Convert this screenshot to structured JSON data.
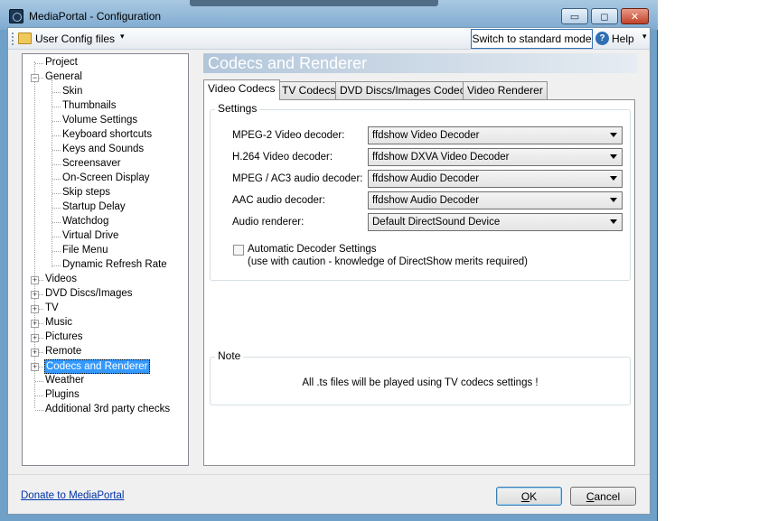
{
  "window": {
    "title": "MediaPortal - Configuration",
    "min_glyph": "▭",
    "max_glyph": "◻",
    "close_glyph": "✕"
  },
  "toolbar": {
    "config_menu_label": "User Config files",
    "dropdown_glyph": "▾",
    "switch_mode_label": "Switch to standard mode",
    "help_glyph": "?",
    "help_label": "Help"
  },
  "tree": {
    "items": [
      {
        "label": "Project",
        "level": 1,
        "expander": ""
      },
      {
        "label": "General",
        "level": 0,
        "expander": "−"
      },
      {
        "label": "Skin",
        "level": 2,
        "expander": ""
      },
      {
        "label": "Thumbnails",
        "level": 2,
        "expander": ""
      },
      {
        "label": "Volume Settings",
        "level": 2,
        "expander": ""
      },
      {
        "label": "Keyboard shortcuts",
        "level": 2,
        "expander": ""
      },
      {
        "label": "Keys and Sounds",
        "level": 2,
        "expander": ""
      },
      {
        "label": "Screensaver",
        "level": 2,
        "expander": ""
      },
      {
        "label": "On-Screen Display",
        "level": 2,
        "expander": ""
      },
      {
        "label": "Skip steps",
        "level": 2,
        "expander": ""
      },
      {
        "label": "Startup Delay",
        "level": 2,
        "expander": ""
      },
      {
        "label": "Watchdog",
        "level": 2,
        "expander": ""
      },
      {
        "label": "Virtual Drive",
        "level": 2,
        "expander": ""
      },
      {
        "label": "File Menu",
        "level": 2,
        "expander": ""
      },
      {
        "label": "Dynamic Refresh Rate",
        "level": 2,
        "expander": ""
      },
      {
        "label": "Videos",
        "level": 0,
        "expander": "+"
      },
      {
        "label": "DVD Discs/Images",
        "level": 0,
        "expander": "+"
      },
      {
        "label": "TV",
        "level": 0,
        "expander": "+"
      },
      {
        "label": "Music",
        "level": 0,
        "expander": "+"
      },
      {
        "label": "Pictures",
        "level": 0,
        "expander": "+"
      },
      {
        "label": "Remote",
        "level": 0,
        "expander": "+"
      },
      {
        "label": "Codecs and Renderer",
        "level": 0,
        "expander": "+",
        "selected": true
      },
      {
        "label": "Weather",
        "level": 1,
        "expander": ""
      },
      {
        "label": "Plugins",
        "level": 1,
        "expander": ""
      },
      {
        "label": "Additional 3rd party checks",
        "level": 1,
        "expander": ""
      }
    ]
  },
  "main": {
    "header": "Codecs and Renderer",
    "tabs": [
      {
        "label": "Video Codecs",
        "active": true
      },
      {
        "label": "TV Codecs",
        "active": false
      },
      {
        "label": "DVD Discs/Images Codecs",
        "active": false
      },
      {
        "label": "Video Renderer",
        "active": false
      }
    ],
    "settings": {
      "group_label": "Settings",
      "fields": [
        {
          "label": "MPEG-2 Video decoder:",
          "value": "ffdshow Video Decoder"
        },
        {
          "label": "H.264 Video decoder:",
          "value": "ffdshow DXVA Video Decoder"
        },
        {
          "label": "MPEG / AC3 audio decoder:",
          "value": "ffdshow Audio Decoder"
        },
        {
          "label": "AAC audio decoder:",
          "value": "ffdshow Audio Decoder"
        },
        {
          "label": "Audio renderer:",
          "value": "Default DirectSound Device"
        }
      ],
      "auto_decoder_label": "Automatic  Decoder Settings",
      "auto_decoder_note": "(use with caution - knowledge of DirectShow merits required)",
      "auto_decoder_checked": false
    },
    "note": {
      "group_label": "Note",
      "text": "All .ts files will be played using TV codecs settings !"
    }
  },
  "footer": {
    "donate_label": "Donate to MediaPortal",
    "ok_label": "OK",
    "cancel_label": "Cancel"
  },
  "colors": {
    "frame": "#6fa0c8",
    "selection": "#3399ff",
    "link": "#0033aa"
  }
}
